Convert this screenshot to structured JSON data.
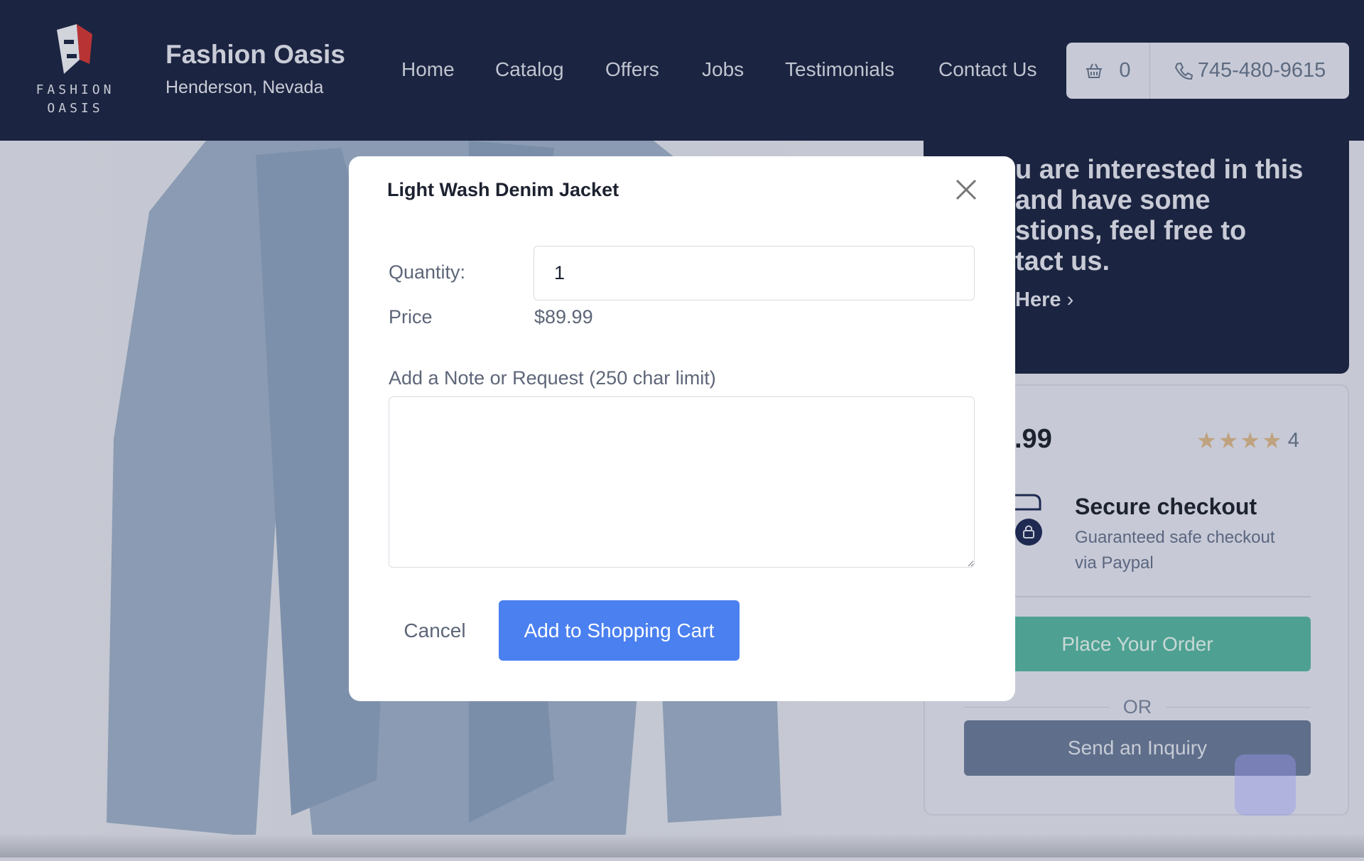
{
  "header": {
    "logo_text": [
      "FASHION",
      "OASIS"
    ],
    "brand": "Fashion Oasis",
    "location": "Henderson, Nevada",
    "nav": [
      "Home",
      "Catalog",
      "Offers",
      "Jobs",
      "Testimonials",
      "Contact Us"
    ],
    "cart_count": "0",
    "phone": "745-480-9615",
    "icons": [
      "basket-icon",
      "phone-icon"
    ]
  },
  "contact_panel": {
    "lines": [
      "u are interested in this",
      " and have some",
      "stions, feel free to",
      "tact us."
    ],
    "link": "Here"
  },
  "product_card": {
    "price_fragment": ".99",
    "rating": "4",
    "rating_stars": 4,
    "secure_title": "Secure checkout",
    "secure_sub": [
      "Guaranteed safe checkout",
      "via Paypal"
    ],
    "place_order": "Place Your Order",
    "or": "OR",
    "inquiry": "Send an Inquiry"
  },
  "modal": {
    "title": "Light Wash Denim Jacket",
    "quantity_label": "Quantity:",
    "quantity_value": "1",
    "price_label": "Price",
    "price_value": "$89.99",
    "note_label": "Add a Note or Request (250 char limit)",
    "note_value": "",
    "cancel": "Cancel",
    "add": "Add to Shopping Cart"
  },
  "colors": {
    "header": "#1b2440",
    "primary": "#4a80f0",
    "order": "#4ea192",
    "inquiry": "#5f6e8a",
    "star": "#bfa27f"
  }
}
